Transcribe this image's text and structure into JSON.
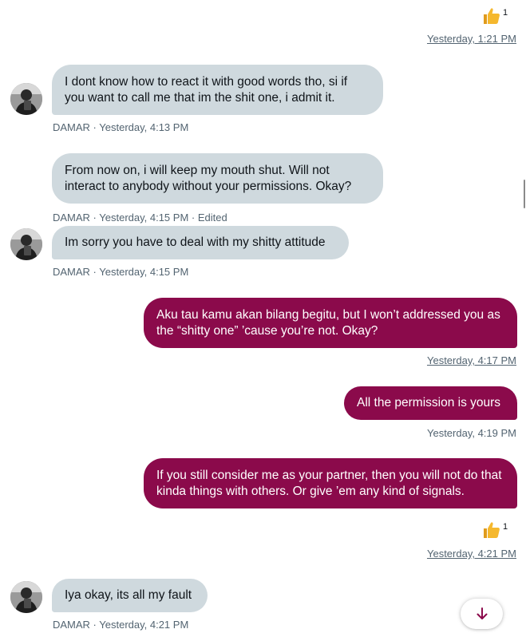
{
  "colors": {
    "incoming_bubble": "#cfd9de",
    "outgoing_bubble": "#8b0a4b",
    "meta_text": "#536471",
    "reaction": "#f5b82e"
  },
  "top_reaction": {
    "emoji": "thumbs-up-icon",
    "count": "1"
  },
  "top_timestamp": "Yesterday, 1:21 PM",
  "messages": [
    {
      "direction": "incoming",
      "text": "I dont know how to react it with good words tho, si if you want to call me that im the shit one, i admit it.",
      "meta": "DAMAR · Yesterday, 4:13 PM"
    },
    {
      "direction": "incoming",
      "text": "From now on, i will keep my mouth shut.  Will not interact to anybody without your permissions. Okay?",
      "meta": "DAMAR · Yesterday, 4:15 PM · Edited"
    },
    {
      "direction": "incoming",
      "text": "Im sorry you have to deal with my shitty attitude",
      "meta": "DAMAR · Yesterday, 4:15 PM"
    },
    {
      "direction": "outgoing",
      "text": "Aku tau kamu akan bilang begitu, but I won’t addressed you as the “shitty one” ’cause you’re not. Okay?",
      "meta": "Yesterday, 4:17 PM"
    },
    {
      "direction": "outgoing",
      "text": "All the permission is yours",
      "meta": "Yesterday, 4:19 PM"
    },
    {
      "direction": "outgoing",
      "text": "If you still consider me as your partner, then you will not do that kinda things with others. Or give ’em any kind of signals.",
      "reaction": {
        "emoji": "thumbs-up-icon",
        "count": "1"
      },
      "meta": "Yesterday, 4:21 PM"
    },
    {
      "direction": "incoming",
      "text": "Iya okay, its all my fault",
      "meta": "DAMAR · Yesterday, 4:21 PM"
    }
  ],
  "scroll_down_button": {
    "icon": "arrow-down-icon"
  }
}
